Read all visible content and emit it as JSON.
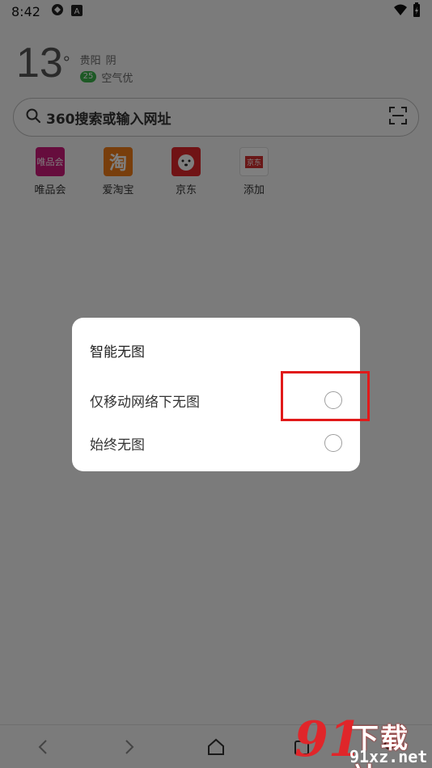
{
  "status_bar": {
    "time": "8:42",
    "icons": [
      "sync-icon",
      "a-icon"
    ],
    "right_icons": [
      "wifi-icon",
      "battery-charging-icon"
    ]
  },
  "weather": {
    "temperature": "13",
    "degree": "°",
    "city": "贵阳",
    "condition": "阴",
    "aqi_value": "25",
    "aqi_text": "空气优"
  },
  "search": {
    "placeholder": "360搜索或输入网址",
    "icon": "search-icon",
    "scan_icon": "scan-icon"
  },
  "shortcuts": [
    {
      "label": "唯品会",
      "icon_text": "唯品会",
      "color": "#cc1a7a"
    },
    {
      "label": "爱淘宝",
      "icon_text": "淘",
      "color": "#f07d18"
    },
    {
      "label": "京东",
      "icon_text": "",
      "color": "#e0262a"
    },
    {
      "label": "添加",
      "icon_text": "京东",
      "color": "#d32f2f"
    }
  ],
  "dialog": {
    "title": "智能无图",
    "options": [
      {
        "label": "仅移动网络下无图",
        "selected": false
      },
      {
        "label": "始终无图",
        "selected": false
      }
    ]
  },
  "bottom_nav": [
    "back-icon",
    "forward-icon",
    "home-icon",
    "tabs-icon",
    "user-icon"
  ],
  "watermark": {
    "number": "91",
    "top_text": "下载站",
    "bottom_text": "91xz.net"
  }
}
